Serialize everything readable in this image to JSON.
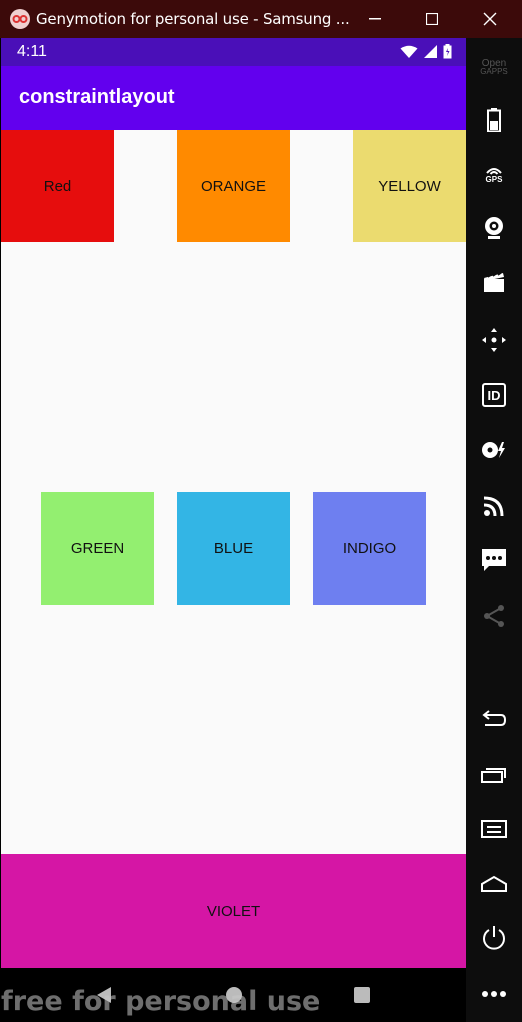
{
  "window": {
    "title": "Genymotion for personal use - Samsung ..."
  },
  "status_bar": {
    "time": "4:11"
  },
  "app_bar": {
    "title": "constraintlayout"
  },
  "boxes": {
    "red": {
      "label": "Red",
      "color": "#e60d0d"
    },
    "orange": {
      "label": "ORANGE",
      "color": "#ff8a00"
    },
    "yellow": {
      "label": "YELLOW",
      "color": "#ebdb6f"
    },
    "green": {
      "label": "GREEN",
      "color": "#93ef70"
    },
    "blue": {
      "label": "BLUE",
      "color": "#33b5e5"
    },
    "indigo": {
      "label": "INDIGO",
      "color": "#6e7ff0"
    },
    "violet": {
      "label": "VIOLET",
      "color": "#d516a5"
    }
  },
  "watermark": "free for personal use",
  "toolbar": {
    "opengapps_label_top": "Open",
    "opengapps_label_bottom": "GAPPS",
    "gps_label": "GPS",
    "id_label": "ID"
  },
  "colors": {
    "status_bar": "#4a0fb8",
    "app_bar": "#6200ee",
    "title_bar": "#3c0a0a"
  }
}
